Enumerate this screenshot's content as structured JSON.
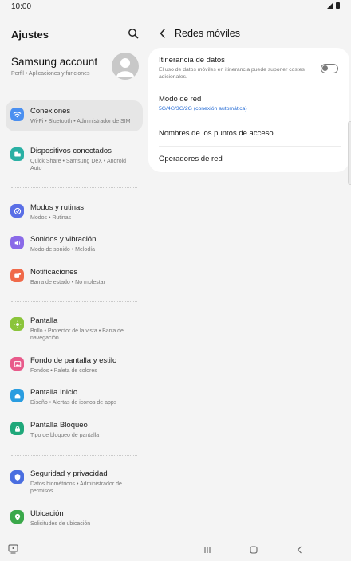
{
  "status": {
    "time": "10:00"
  },
  "left": {
    "title": "Ajustes",
    "account": {
      "name": "Samsung account",
      "sub": "Perfil  •  Aplicaciones y funciones"
    },
    "items": [
      {
        "title": "Conexiones",
        "sub": "Wi-Fi  •  Bluetooth  •  Administrador de SIM",
        "color": "#4a8ff0"
      },
      {
        "title": "Dispositivos conectados",
        "sub": "Quick Share  •  Samsung DeX  •  Android Auto",
        "color": "#2ab0a4"
      },
      {
        "title": "Modos y rutinas",
        "sub": "Modos  •  Rutinas",
        "color": "#5a6fe6"
      },
      {
        "title": "Sonidos y vibración",
        "sub": "Modo de sonido  •  Melodía",
        "color": "#8a6ae8"
      },
      {
        "title": "Notificaciones",
        "sub": "Barra de estado  •  No molestar",
        "color": "#f06a4a"
      },
      {
        "title": "Pantalla",
        "sub": "Brillo  •  Protector de la vista  •  Barra de navegación",
        "color": "#8ac43a"
      },
      {
        "title": "Fondo de pantalla y estilo",
        "sub": "Fondos  •  Paleta de colores",
        "color": "#e85a8a"
      },
      {
        "title": "Pantalla Inicio",
        "sub": "Diseño  •  Alertas de iconos de apps",
        "color": "#2a9de0"
      },
      {
        "title": "Pantalla Bloqueo",
        "sub": "Tipo de bloqueo de pantalla",
        "color": "#1fa87a"
      },
      {
        "title": "Seguridad y privacidad",
        "sub": "Datos biométricos  •  Administrador de permisos",
        "color": "#4a6ee0"
      },
      {
        "title": "Ubicación",
        "sub": "Solicitudes de ubicación",
        "color": "#3aa84a"
      }
    ]
  },
  "right": {
    "title": "Redes móviles",
    "rows": [
      {
        "title": "Itinerancia de datos",
        "sub": "El uso de datos móviles en itinerancia puede suponer costes adicionales."
      },
      {
        "title": "Modo de red",
        "sub": "5G/4G/3G/2G (conexión automática)"
      },
      {
        "title": "Nombres de los puntos de acceso"
      },
      {
        "title": "Operadores de red"
      }
    ],
    "roaming_enabled": false
  }
}
